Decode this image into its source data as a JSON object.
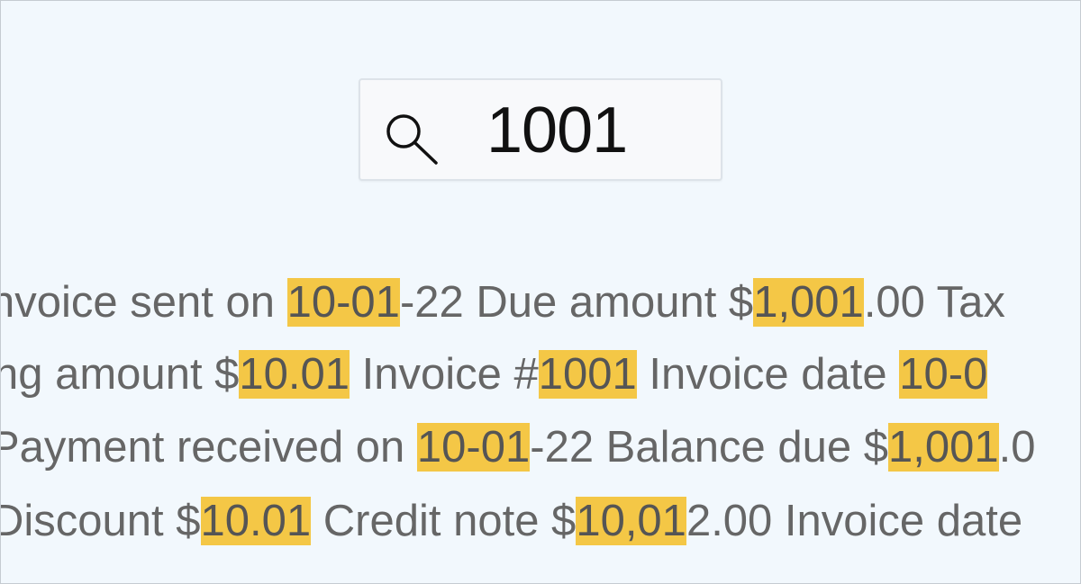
{
  "search": {
    "query": "1001",
    "icon": "search-icon"
  },
  "results": [
    [
      {
        "t": "nvoice sent on ",
        "h": false
      },
      {
        "t": "10-01",
        "h": true
      },
      {
        "t": "-22 Due amount $",
        "h": false
      },
      {
        "t": "1,001",
        "h": true
      },
      {
        "t": ".00 Tax",
        "h": false
      }
    ],
    [
      {
        "t": "ng amount $",
        "h": false
      },
      {
        "t": "10.01",
        "h": true
      },
      {
        "t": " Invoice #",
        "h": false
      },
      {
        "t": "1001",
        "h": true
      },
      {
        "t": " Invoice date ",
        "h": false
      },
      {
        "t": "10-0",
        "h": true
      }
    ],
    [
      {
        "t": "Payment received on ",
        "h": false
      },
      {
        "t": "10-01",
        "h": true
      },
      {
        "t": "-22 Balance due $",
        "h": false
      },
      {
        "t": "1,001",
        "h": true
      },
      {
        "t": ".0",
        "h": false
      }
    ],
    [
      {
        "t": "Discount $",
        "h": false
      },
      {
        "t": "10.01",
        "h": true
      },
      {
        "t": " Credit note $",
        "h": false
      },
      {
        "t": "10,01",
        "h": true
      },
      {
        "t": "2.00 Invoice date",
        "h": false
      }
    ]
  ],
  "colors": {
    "background": "#f2f8fd",
    "highlight": "#f4c746",
    "text": "#666666"
  }
}
